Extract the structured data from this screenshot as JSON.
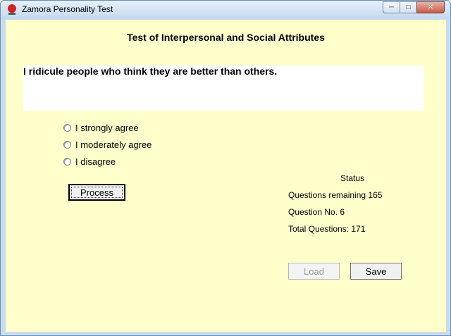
{
  "window": {
    "title": "Zamora Personality Test",
    "controls": {
      "minimize_icon": "minimize-icon",
      "maximize_icon": "maximize-icon",
      "close_icon": "close-icon"
    }
  },
  "test": {
    "heading": "Test of Interpersonal and Social Attributes",
    "question": "I ridicule people who think they are better than others.",
    "options": [
      "I strongly agree",
      "I moderately agree",
      "I disagree"
    ],
    "selected_option": null
  },
  "buttons": {
    "process": "Process",
    "load": "Load",
    "save": "Save"
  },
  "status": {
    "title": "Status",
    "questions_remaining": "Questions remaining 165",
    "question_no": "Question No. 6",
    "total_questions": "Total Questions: 171"
  },
  "colors": {
    "client_bg": "#ffffcc",
    "question_bg": "#ffffff"
  }
}
